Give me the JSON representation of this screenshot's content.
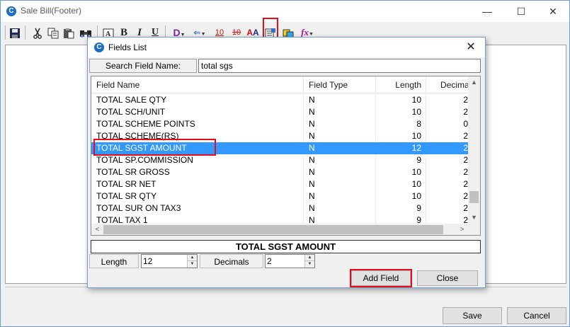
{
  "main_window": {
    "title": "Sale Bill(Footer)",
    "app_icon": "app-logo-icon",
    "controls": {
      "minimize": "—",
      "maximize": "☐",
      "close": "✕"
    }
  },
  "toolbar": {
    "items": [
      {
        "name": "save-icon",
        "glyph": "💾"
      },
      {
        "name": "cut-icon",
        "glyph": "✂"
      },
      {
        "name": "copy-icon",
        "glyph": "⧉"
      },
      {
        "name": "paste-icon",
        "glyph": "📋"
      },
      {
        "name": "find-icon",
        "glyph": "🔭"
      },
      {
        "name": "text-box-icon",
        "glyph": "A"
      },
      {
        "name": "bold-icon",
        "glyph": "B"
      },
      {
        "name": "italic-icon",
        "glyph": "I"
      },
      {
        "name": "underline-icon",
        "glyph": "U"
      },
      {
        "name": "date-dropdown-icon",
        "glyph": "D"
      },
      {
        "name": "arrow-dropdown-icon",
        "glyph": "⇐"
      },
      {
        "name": "font-size-icon",
        "glyph": "10"
      },
      {
        "name": "font-size-alt-icon",
        "glyph": "10"
      },
      {
        "name": "font-style-icon",
        "glyph": "AA"
      },
      {
        "name": "fields-list-icon",
        "glyph": "▦"
      },
      {
        "name": "insert-object-icon",
        "glyph": "◆"
      },
      {
        "name": "function-dropdown-icon",
        "glyph": "fx"
      }
    ]
  },
  "dialog": {
    "title": "Fields List",
    "close_glyph": "✕",
    "search": {
      "label": "Search Field Name:",
      "value": "total sgs"
    },
    "columns": {
      "name": "Field Name",
      "type": "Field Type",
      "length": "Length",
      "decimal": "Decimal"
    },
    "rows": [
      {
        "name": "TOTAL SALE QTY",
        "type": "N",
        "length": "10",
        "decimal": "2"
      },
      {
        "name": "TOTAL SCH/UNIT",
        "type": "N",
        "length": "10",
        "decimal": "2"
      },
      {
        "name": "TOTAL SCHEME POINTS",
        "type": "N",
        "length": "8",
        "decimal": "0"
      },
      {
        "name": "TOTAL SCHEME(RS)",
        "type": "N",
        "length": "10",
        "decimal": "2"
      },
      {
        "name": "TOTAL SGST AMOUNT",
        "type": "N",
        "length": "12",
        "decimal": "2",
        "selected": true
      },
      {
        "name": "TOTAL SP.COMMISSION",
        "type": "N",
        "length": "9",
        "decimal": "2"
      },
      {
        "name": "TOTAL SR GROSS",
        "type": "N",
        "length": "10",
        "decimal": "2"
      },
      {
        "name": "TOTAL SR NET",
        "type": "N",
        "length": "10",
        "decimal": "2"
      },
      {
        "name": "TOTAL SR QTY",
        "type": "N",
        "length": "10",
        "decimal": "2"
      },
      {
        "name": "TOTAL SUR ON TAX3",
        "type": "N",
        "length": "9",
        "decimal": "2"
      },
      {
        "name": "TOTAL TAX 1",
        "type": "N",
        "length": "9",
        "decimal": "2"
      }
    ],
    "selected_field": "TOTAL SGST AMOUNT",
    "length": {
      "label": "Length",
      "value": "12"
    },
    "decimals": {
      "label": "Decimals",
      "value": "2"
    },
    "add_field_label": "Add Field",
    "close_label": "Close",
    "scroll": {
      "up": "▲",
      "down": "▼",
      "left": "<",
      "right": ">"
    }
  },
  "footer": {
    "save_label": "Save",
    "cancel_label": "Cancel"
  },
  "colors": {
    "selection": "#3399ff",
    "highlight_box": "#e30e17",
    "title_icon": "#1c6dc4"
  }
}
